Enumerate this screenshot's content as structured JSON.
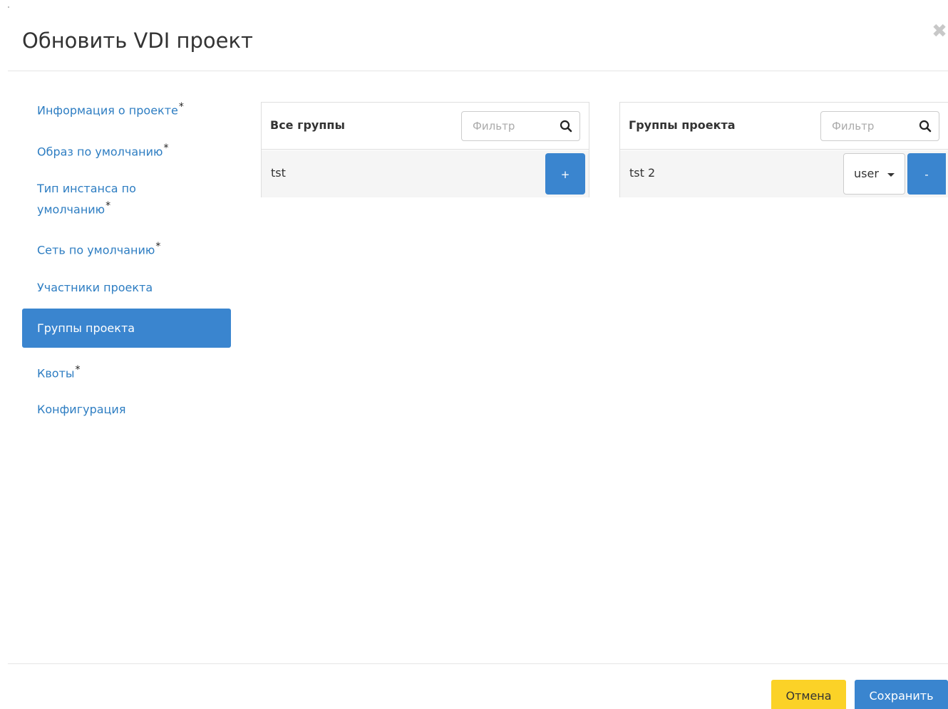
{
  "modal": {
    "title": "Обновить VDI проект",
    "close_symbol": "✖"
  },
  "nav": {
    "items": [
      {
        "label": "Информация о проекте",
        "required": "*"
      },
      {
        "label": "Образ по умолчанию",
        "required": "*"
      },
      {
        "label": "Тип инстанса по",
        "label2": "умолчанию",
        "required": "*"
      },
      {
        "label": "Сеть по умолчанию",
        "required": "*"
      },
      {
        "label": "Участники проекта"
      },
      {
        "label": "Группы проекта",
        "active": true
      },
      {
        "label": "Квоты",
        "required": "*"
      },
      {
        "label": "Конфигурация"
      }
    ]
  },
  "all_groups": {
    "title": "Все группы",
    "filter_placeholder": "Фильтр",
    "rows": [
      {
        "name": "tst",
        "add_label": "+"
      }
    ]
  },
  "project_groups": {
    "title": "Группы проекта",
    "filter_placeholder": "Фильтр",
    "rows": [
      {
        "name": "tst 2",
        "role": "user",
        "remove_label": "-"
      }
    ]
  },
  "footer": {
    "cancel_label": "Отмена",
    "save_label": "Сохранить"
  },
  "colors": {
    "accent": "#3a85cf",
    "link": "#2d7dc2",
    "cancel": "#fbd227"
  },
  "icons": {
    "search": "search-icon",
    "close": "close-icon",
    "caret": "caret-down-icon"
  }
}
